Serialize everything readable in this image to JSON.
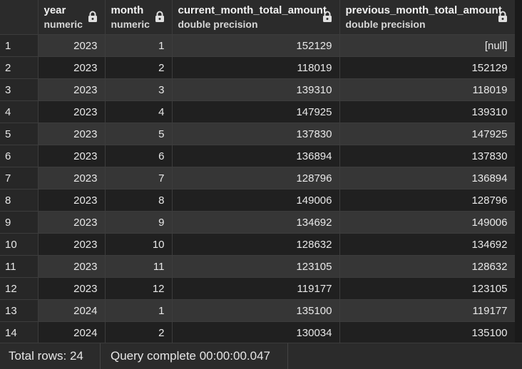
{
  "columns": [
    {
      "name": "year",
      "type": "numeric"
    },
    {
      "name": "month",
      "type": "numeric"
    },
    {
      "name": "current_month_total_amount",
      "type": "double precision"
    },
    {
      "name": "previous_month_total_amount",
      "type": "double precision"
    }
  ],
  "rows": [
    [
      "1",
      "2023",
      "1",
      "152129",
      "[null]"
    ],
    [
      "2",
      "2023",
      "2",
      "118019",
      "152129"
    ],
    [
      "3",
      "2023",
      "3",
      "139310",
      "118019"
    ],
    [
      "4",
      "2023",
      "4",
      "147925",
      "139310"
    ],
    [
      "5",
      "2023",
      "5",
      "137830",
      "147925"
    ],
    [
      "6",
      "2023",
      "6",
      "136894",
      "137830"
    ],
    [
      "7",
      "2023",
      "7",
      "128796",
      "136894"
    ],
    [
      "8",
      "2023",
      "8",
      "149006",
      "128796"
    ],
    [
      "9",
      "2023",
      "9",
      "134692",
      "149006"
    ],
    [
      "10",
      "2023",
      "10",
      "128632",
      "134692"
    ],
    [
      "11",
      "2023",
      "11",
      "123105",
      "128632"
    ],
    [
      "12",
      "2023",
      "12",
      "119177",
      "123105"
    ],
    [
      "13",
      "2024",
      "1",
      "135100",
      "119177"
    ],
    [
      "14",
      "2024",
      "2",
      "130034",
      "135100"
    ]
  ],
  "status": {
    "total_rows": "Total rows: 24",
    "query": "Query complete 00:00:00.047"
  },
  "icons": {
    "column_lock": "lock-icon"
  }
}
